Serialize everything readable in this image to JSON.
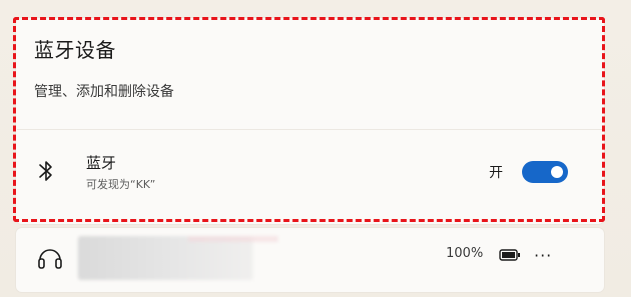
{
  "bluetooth_section": {
    "title": "蓝牙设备",
    "subtitle": "管理、添加和删除设备"
  },
  "bluetooth_row": {
    "name": "蓝牙",
    "description": "可发现为“KK”",
    "toggle_label": "开",
    "toggle_on": true
  },
  "device_row": {
    "battery": "100%",
    "more": "···"
  },
  "colors": {
    "accent": "#1667c9",
    "highlight_border": "#e8141a"
  },
  "icons": [
    "bluetooth-icon",
    "headphones-icon",
    "battery-icon",
    "more-options-icon"
  ]
}
